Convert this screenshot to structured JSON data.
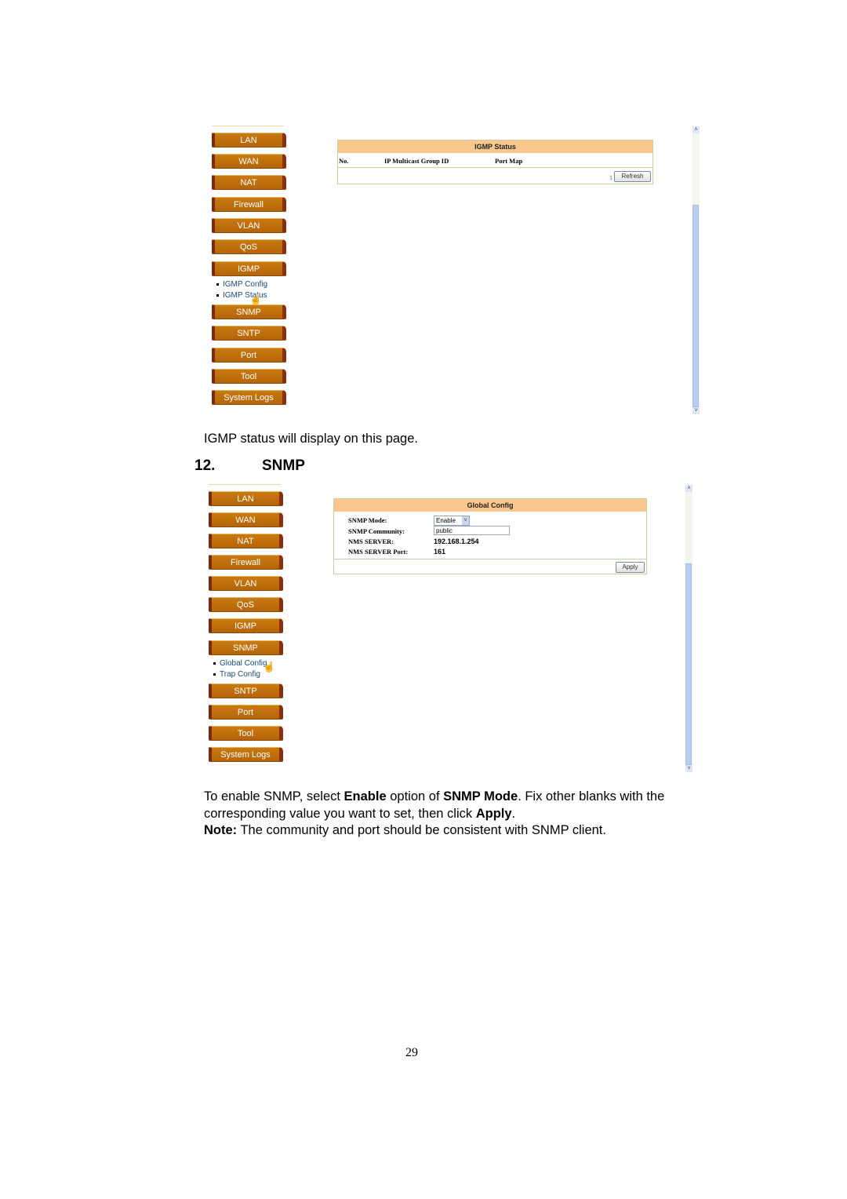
{
  "screenshot1": {
    "nav": {
      "items_before": [
        "LAN",
        "WAN",
        "NAT",
        "Firewall",
        "VLAN",
        "QoS",
        "IGMP"
      ],
      "submenu": [
        "IGMP Config",
        "IGMP Status"
      ],
      "items_after": [
        "SNMP",
        "SNTP",
        "Port",
        "Tool",
        "System Logs"
      ]
    },
    "panel": {
      "title": "IGMP Status",
      "columns": [
        "No.",
        "IP Multicast Group ID",
        "Port Map"
      ],
      "page_indicator": "1",
      "refresh_label": "Refresh"
    },
    "scrollbar": {
      "up": "˄",
      "down": "˅"
    }
  },
  "caption1": "IGMP status will display on this page.",
  "section": {
    "number": "12.",
    "title": "SNMP"
  },
  "screenshot2": {
    "nav": {
      "items_before": [
        "LAN",
        "WAN",
        "NAT",
        "Firewall",
        "VLAN",
        "QoS",
        "IGMP",
        "SNMP"
      ],
      "submenu": [
        "Global Config",
        "Trap Config"
      ],
      "items_after": [
        "SNTP",
        "Port",
        "Tool",
        "System Logs"
      ]
    },
    "panel": {
      "title": "Global Config",
      "fields": [
        {
          "label": "SNMP Mode:",
          "value": "Enable"
        },
        {
          "label": "SNMP Community:",
          "value": "public"
        },
        {
          "label": "NMS SERVER:",
          "value": "192.168.1.254"
        },
        {
          "label": "NMS SERVER Port:",
          "value": "161"
        }
      ],
      "apply_label": "Apply"
    },
    "scrollbar": {
      "up": "˄",
      "down": "˅"
    }
  },
  "paragraph": {
    "p1_a": "To enable SNMP, select ",
    "p1_b": "Enable",
    "p1_c": " option of ",
    "p1_d": "SNMP Mode",
    "p1_e": ". Fix other blanks with the",
    "p2_a": "corresponding value you want to set, then click ",
    "p2_b": "Apply",
    "p2_c": ".",
    "note_label": "Note:",
    "note_text": " The community and port should be consistent with SNMP client."
  },
  "page_number": "29"
}
